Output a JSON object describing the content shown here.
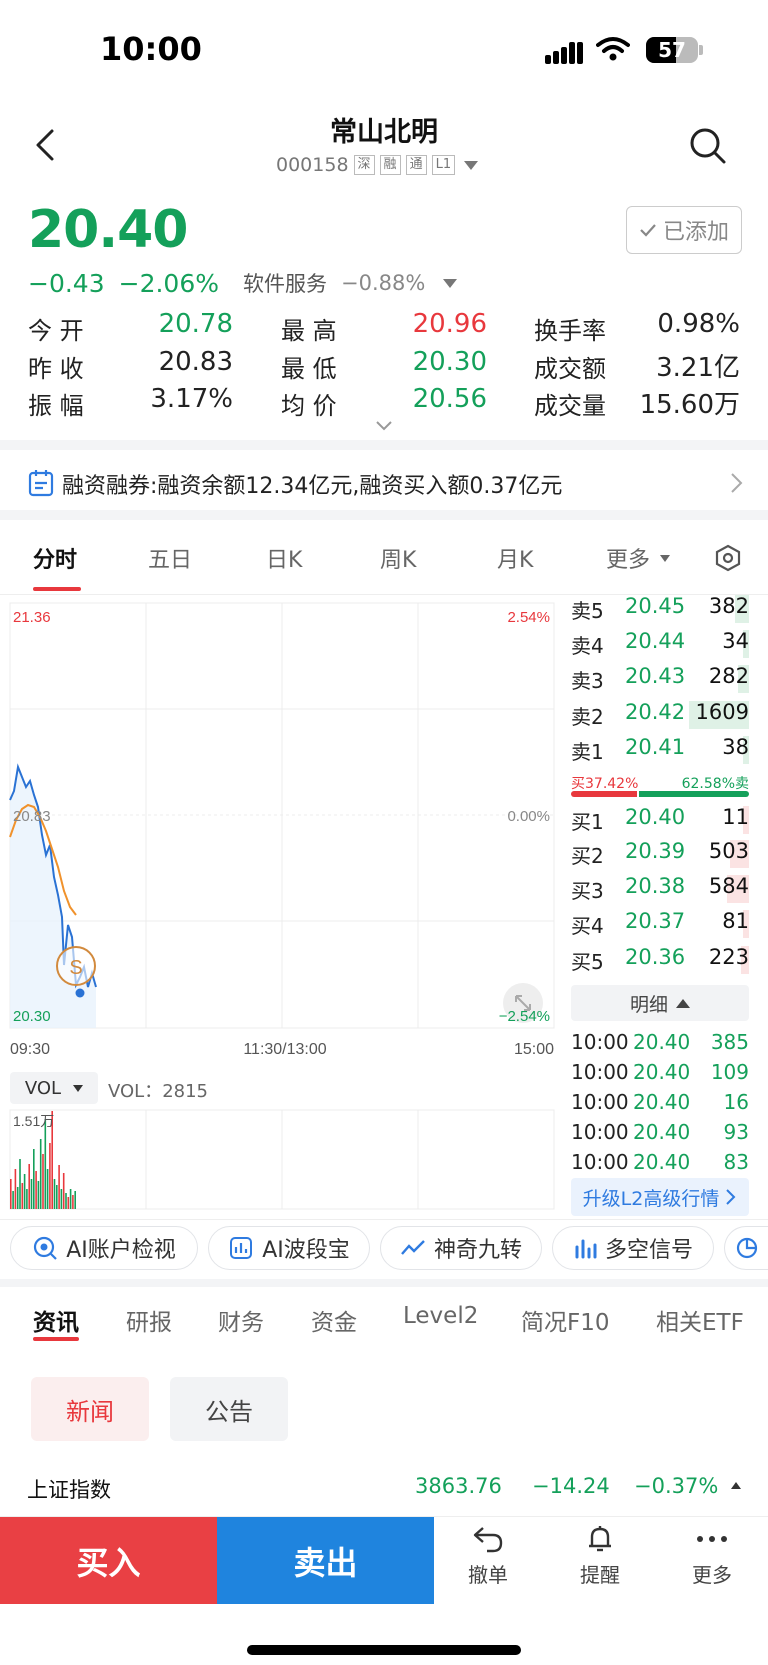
{
  "status": {
    "time": "10:00",
    "battery": "57"
  },
  "header": {
    "title": "常山北明",
    "code": "000158",
    "tags": [
      "深",
      "融",
      "通",
      "L1"
    ]
  },
  "quote": {
    "price": "20.40",
    "change": "−0.43",
    "change_pct": "−2.06%",
    "sector": "软件服务",
    "sector_chg": "−0.88%",
    "added_label": "已添加"
  },
  "stats": [
    {
      "label": "今 开",
      "value": "20.78",
      "color": "green"
    },
    {
      "label": "最 高",
      "value": "20.96",
      "color": "red"
    },
    {
      "label": "换手率",
      "value": "0.98%",
      "color": "black"
    },
    {
      "label": "昨 收",
      "value": "20.83",
      "color": "black"
    },
    {
      "label": "最 低",
      "value": "20.30",
      "color": "green"
    },
    {
      "label": "成交额",
      "value": "3.21亿",
      "color": "black"
    },
    {
      "label": "振 幅",
      "value": "3.17%",
      "color": "black"
    },
    {
      "label": "均 价",
      "value": "20.56",
      "color": "green"
    },
    {
      "label": "成交量",
      "value": "15.60万",
      "color": "black"
    }
  ],
  "margin": {
    "text": "融资融券:融资余额12.34亿元,融资买入额0.37亿元"
  },
  "chart_tabs": [
    "分时",
    "五日",
    "日K",
    "周K",
    "月K",
    "更多"
  ],
  "chart": {
    "y_high": "21.36",
    "y_mid": "20.83",
    "y_low": "20.30",
    "pct_high": "2.54%",
    "pct_mid": "0.00%",
    "pct_low": "−2.54%",
    "x_start": "09:30",
    "x_mid": "11:30/13:00",
    "x_end": "15:00",
    "vol_label": "VOL",
    "vol_value": "VOL：2815",
    "vol_max": "1.51万"
  },
  "order_book": {
    "asks": [
      {
        "label": "卖5",
        "price": "20.45",
        "qty": "382"
      },
      {
        "label": "卖4",
        "price": "20.44",
        "qty": "34"
      },
      {
        "label": "卖3",
        "price": "20.43",
        "qty": "282"
      },
      {
        "label": "卖2",
        "price": "20.42",
        "qty": "1609"
      },
      {
        "label": "卖1",
        "price": "20.41",
        "qty": "38"
      }
    ],
    "buy_ratio": "买37.42%",
    "sell_ratio": "62.58%卖",
    "buy_fraction": 0.3742,
    "bids": [
      {
        "label": "买1",
        "price": "20.40",
        "qty": "11"
      },
      {
        "label": "买2",
        "price": "20.39",
        "qty": "503"
      },
      {
        "label": "买3",
        "price": "20.38",
        "qty": "584"
      },
      {
        "label": "买4",
        "price": "20.37",
        "qty": "81"
      },
      {
        "label": "买5",
        "price": "20.36",
        "qty": "223"
      }
    ],
    "detail_label": "明细",
    "ticks": [
      {
        "time": "10:00",
        "price": "20.40",
        "qty": "385"
      },
      {
        "time": "10:00",
        "price": "20.40",
        "qty": "109"
      },
      {
        "time": "10:00",
        "price": "20.40",
        "qty": "16"
      },
      {
        "time": "10:00",
        "price": "20.40",
        "qty": "93"
      },
      {
        "time": "10:00",
        "price": "20.40",
        "qty": "83"
      }
    ],
    "upgrade_label": "升级L2高级行情"
  },
  "ai_tools": [
    "AI账户检视",
    "AI波段宝",
    "神奇九转",
    "多空信号"
  ],
  "info_tabs": [
    "资讯",
    "研报",
    "财务",
    "资金",
    "Level2",
    "简况F10",
    "相关ETF"
  ],
  "news_pills": [
    "新闻",
    "公告"
  ],
  "index_ticker": {
    "name": "上证指数",
    "value": "3863.76",
    "change": "−14.24",
    "pct": "−0.37%"
  },
  "bottom_bar": {
    "buy": "买入",
    "sell": "卖出",
    "cancel": "撤单",
    "alert": "提醒",
    "more": "更多"
  },
  "colors": {
    "up": "#e8383d",
    "down": "#14a05a",
    "accent_blue": "#1f84de"
  }
}
